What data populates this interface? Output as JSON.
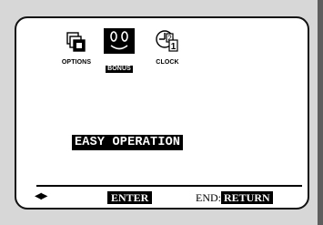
{
  "menu": {
    "icons": [
      {
        "label": "OPTIONS",
        "icon": "options-icon",
        "selected": false
      },
      {
        "label": "BONUS",
        "icon": "bonus-smiley-icon",
        "selected": true
      },
      {
        "label": "CLOCK",
        "icon": "clock-calendar-icon",
        "selected": false
      }
    ],
    "current_option": "EASY OPERATION"
  },
  "footer": {
    "arrows": "◀▶",
    "enter_label": "ENTER",
    "end_label": "END:",
    "return_label": "RETURN"
  },
  "colors": {
    "background": "#d7d7d7",
    "screen": "#ffffff",
    "highlight": "#000000",
    "text": "#000000"
  }
}
